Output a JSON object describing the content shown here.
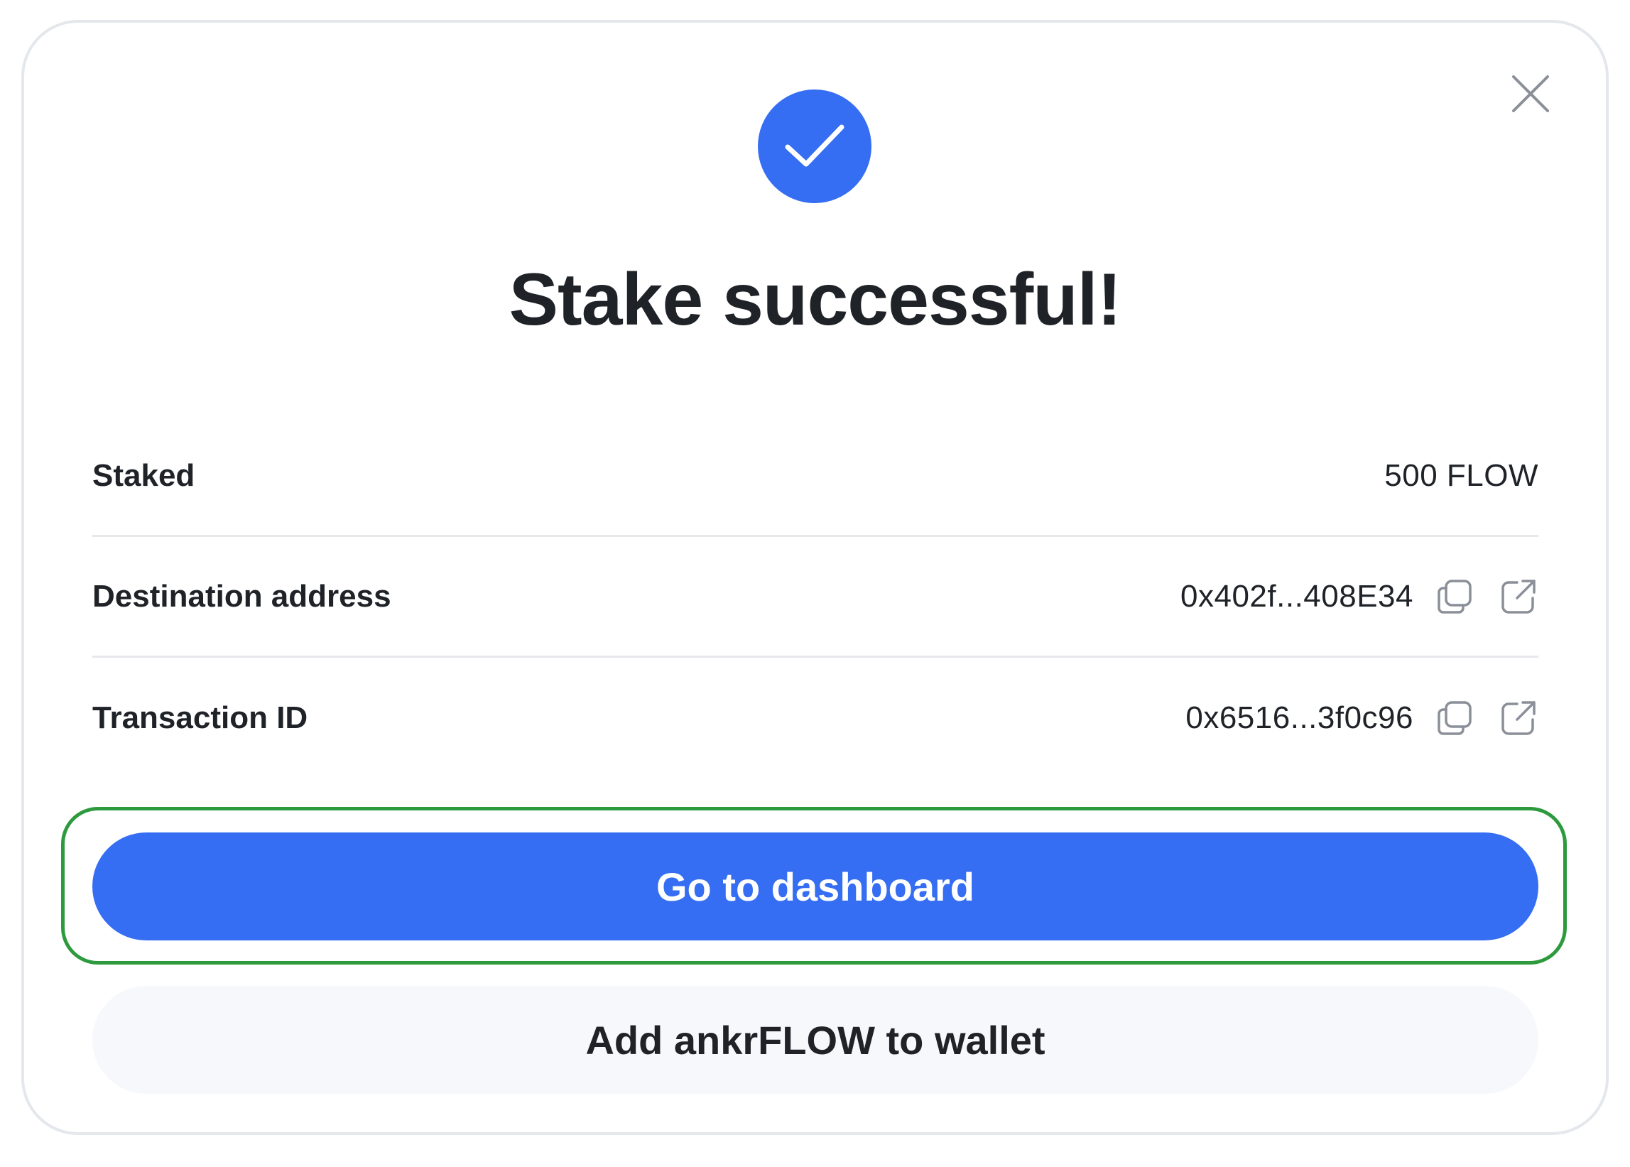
{
  "dialog": {
    "title": "Stake successful!",
    "rows": [
      {
        "label": "Staked",
        "value": "500 FLOW"
      },
      {
        "label": "Destination address",
        "value": "0x402f...408E34"
      },
      {
        "label": "Transaction ID",
        "value": "0x6516...3f0c96"
      }
    ],
    "primary_button": "Go to dashboard",
    "secondary_button": "Add ankrFLOW to wallet"
  },
  "icons": {
    "success": "check-icon",
    "close": "close-icon",
    "copy": "copy-icon",
    "external": "external-link-icon"
  },
  "colors": {
    "accent": "#356df3",
    "highlight": "#2e9a3e",
    "secondary_bg": "#f7f8fc",
    "text": "#1f2328"
  }
}
